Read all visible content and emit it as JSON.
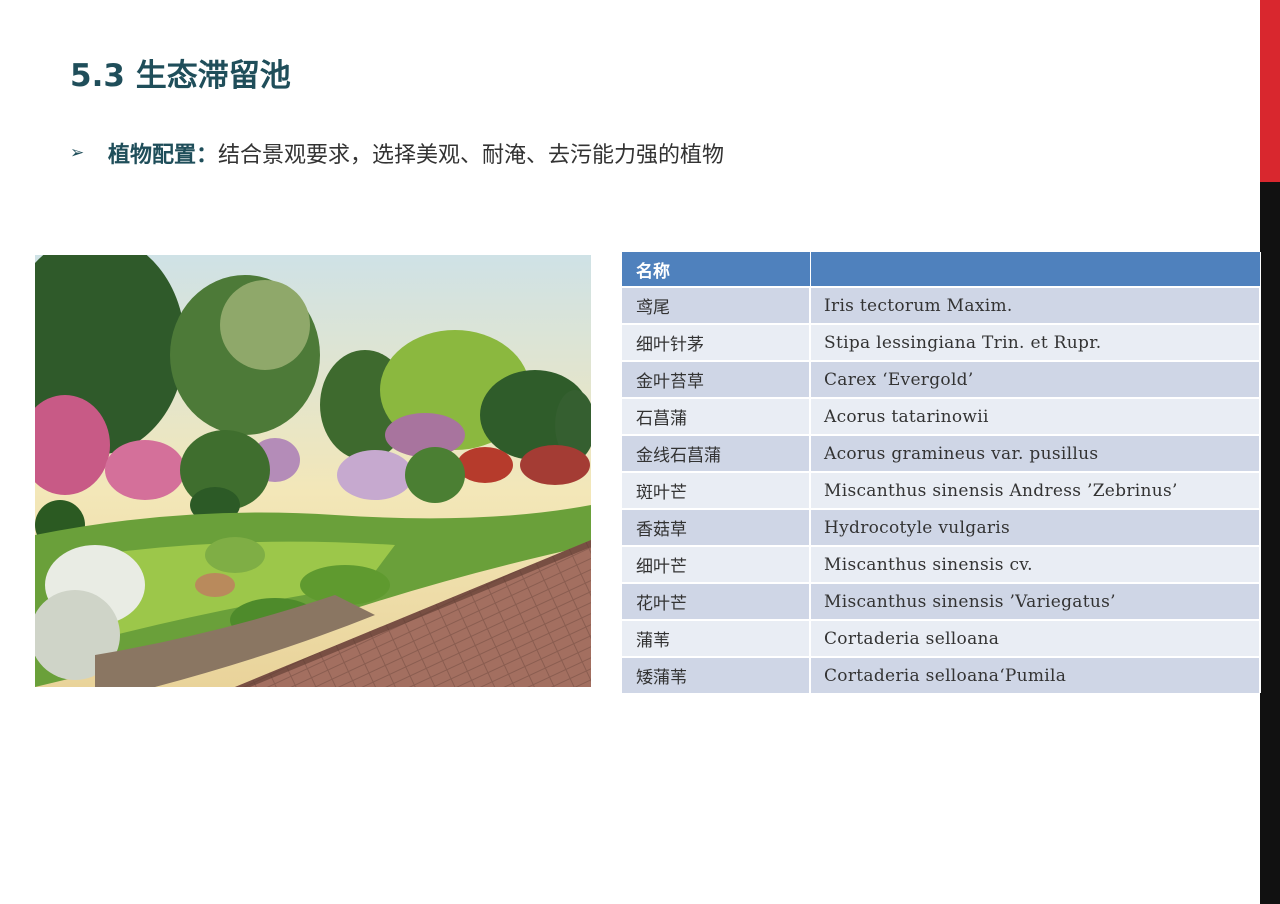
{
  "slide": {
    "title": "5.3 生态滞留池",
    "bullet": {
      "marker": "➢",
      "heading": "植物配置：",
      "text": "结合景观要求，选择美观、耐淹、去污能力强的植物"
    }
  },
  "table": {
    "headers": [
      "名称",
      ""
    ],
    "rows": [
      {
        "cn": "鸢尾",
        "latin": "Iris tectorum Maxim."
      },
      {
        "cn": "细叶针茅",
        "latin": "Stipa lessingiana Trin. et Rupr."
      },
      {
        "cn": "金叶苔草",
        "latin": "Carex ‘Evergold’"
      },
      {
        "cn": "石菖蒲",
        "latin": "Acorus tatarinowii"
      },
      {
        "cn": "金线石菖蒲",
        "latin": "Acorus gramineus var. pusillus"
      },
      {
        "cn": "斑叶芒",
        "latin": "Miscanthus sinensis Andress ’Zebrinus’"
      },
      {
        "cn": "香菇草",
        "latin": "Hydrocotyle vulgaris"
      },
      {
        "cn": "细叶芒",
        "latin": "Miscanthus sinensis cv."
      },
      {
        "cn": "花叶芒",
        "latin": "Miscanthus sinensis ’Variegatus’"
      },
      {
        "cn": "蒲苇",
        "latin": "Cortaderia selloana"
      },
      {
        "cn": "矮蒲苇",
        "latin": "Cortaderia selloana‘Pumila"
      }
    ]
  },
  "colors": {
    "accent_red": "#d9272e",
    "side_black": "#111111",
    "title_teal": "#1f4e5a",
    "table_header_blue": "#4f81bd",
    "row_dark": "#cfd6e6",
    "row_light": "#e9edf4"
  },
  "icons": {
    "bullet": "arrowhead-bullet-icon"
  },
  "image": {
    "description_name": "garden-rendering-photo"
  }
}
